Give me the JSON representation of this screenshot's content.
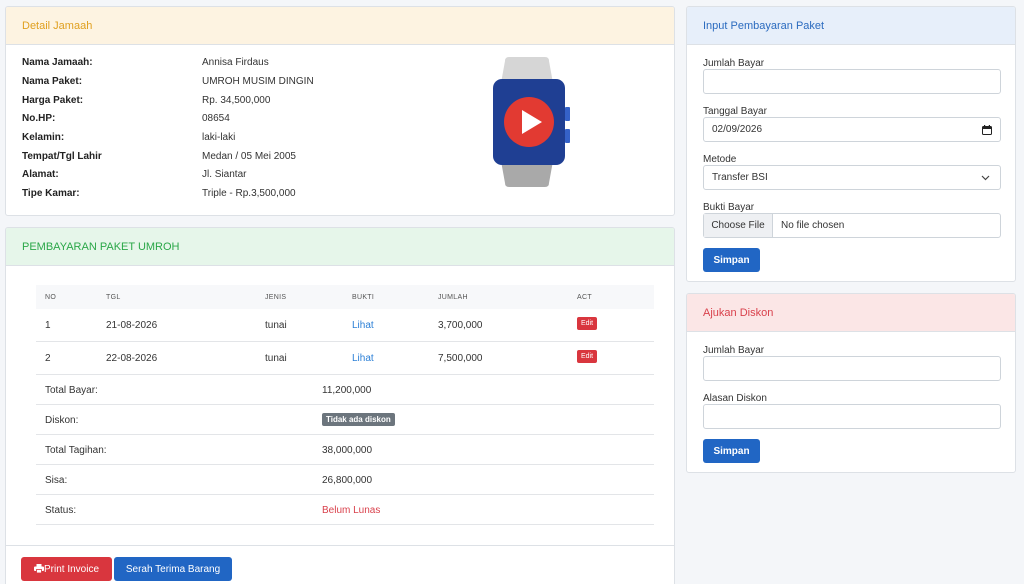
{
  "detail": {
    "header": "Detail Jamaah",
    "rows": [
      {
        "label": "Nama Jamaah:",
        "value": "Annisa Firdaus"
      },
      {
        "label": "Nama Paket:",
        "value": "UMROH MUSIM DINGIN"
      },
      {
        "label": "Harga Paket:",
        "value": "Rp. 34,500,000"
      },
      {
        "label": "No.HP:",
        "value": "08654"
      },
      {
        "label": "Kelamin:",
        "value": "laki-laki"
      },
      {
        "label": "Tempat/Tgl Lahir",
        "value": "Medan / 05 Mei 2005"
      },
      {
        "label": "Alamat:",
        "value": "Jl. Siantar"
      },
      {
        "label": "Tipe Kamar:",
        "value": "Triple - Rp.3,500,000"
      }
    ]
  },
  "payment": {
    "header": "PEMBAYARAN PAKET UMROH",
    "columns": [
      "NO",
      "TGL",
      "JENIS",
      "BUKTI",
      "JUMLAH",
      "ACT"
    ],
    "rows": [
      {
        "no": "1",
        "tgl": "21-08-2026",
        "jenis": "tunai",
        "bukti": "Lihat",
        "jumlah": "3,700,000",
        "act": "Edit"
      },
      {
        "no": "2",
        "tgl": "22-08-2026",
        "jenis": "tunai",
        "bukti": "Lihat",
        "jumlah": "7,500,000",
        "act": "Edit"
      }
    ],
    "summary": {
      "total_bayar_label": "Total Bayar:",
      "total_bayar": "11,200,000",
      "diskon_label": "Diskon:",
      "diskon_badge": "Tidak ada diskon",
      "total_tagihan_label": "Total Tagihan:",
      "total_tagihan": "38,000,000",
      "sisa_label": "Sisa:",
      "sisa": "26,800,000",
      "status_label": "Status:",
      "status": "Belum Lunas"
    },
    "print_button": "Print Invoice",
    "serah_button": "Serah Terima Barang"
  },
  "input_payment": {
    "header": "Input Pembayaran Paket",
    "jumlah_label": "Jumlah Bayar",
    "jumlah_value": "",
    "tanggal_label": "Tanggal Bayar",
    "tanggal_value": "02/09/2026",
    "metode_label": "Metode",
    "metode_value": "Transfer BSI",
    "bukti_label": "Bukti Bayar",
    "file_button": "Choose File",
    "file_status": "No file chosen",
    "submit": "Simpan"
  },
  "discount": {
    "header": "Ajukan Diskon",
    "jumlah_label": "Jumlah Bayar",
    "jumlah_value": "",
    "alasan_label": "Alasan Diskon",
    "alasan_value": "",
    "submit": "Simpan"
  },
  "colors": {
    "primary": "#2166c4",
    "danger": "#d9363e",
    "warning_text": "#e0a020",
    "success_text": "#2aa748",
    "info_text": "#2b6bbf"
  },
  "icons": {
    "watch": "smartwatch-play-icon",
    "print": "printer-icon",
    "calendar": "calendar-icon",
    "chevron": "chevron-down-icon"
  }
}
